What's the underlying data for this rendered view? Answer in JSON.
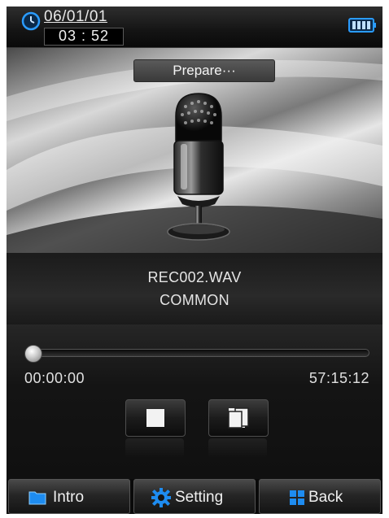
{
  "status_bar": {
    "date": "06/01/01",
    "time": "03 : 52",
    "clock_icon": "clock-icon",
    "battery_icon": "battery-icon"
  },
  "artwork": {
    "status_label": "Prepare···",
    "image_icon": "microphone-icon"
  },
  "file": {
    "name": "REC002.WAV",
    "folder": "COMMON"
  },
  "progress": {
    "elapsed": "00:00:00",
    "total": "57:15:12",
    "fraction": 0.0
  },
  "controls": [
    {
      "name": "stop",
      "icon": "stop-icon"
    },
    {
      "name": "save",
      "icon": "save-icon"
    }
  ],
  "bottom_bar": {
    "intro_label": "Intro",
    "setting_label": "Setting",
    "back_label": "Back"
  },
  "colors": {
    "background": "#0d0d0d",
    "text": "#e4e4e4",
    "accent_blue": "#1e8cf0"
  }
}
